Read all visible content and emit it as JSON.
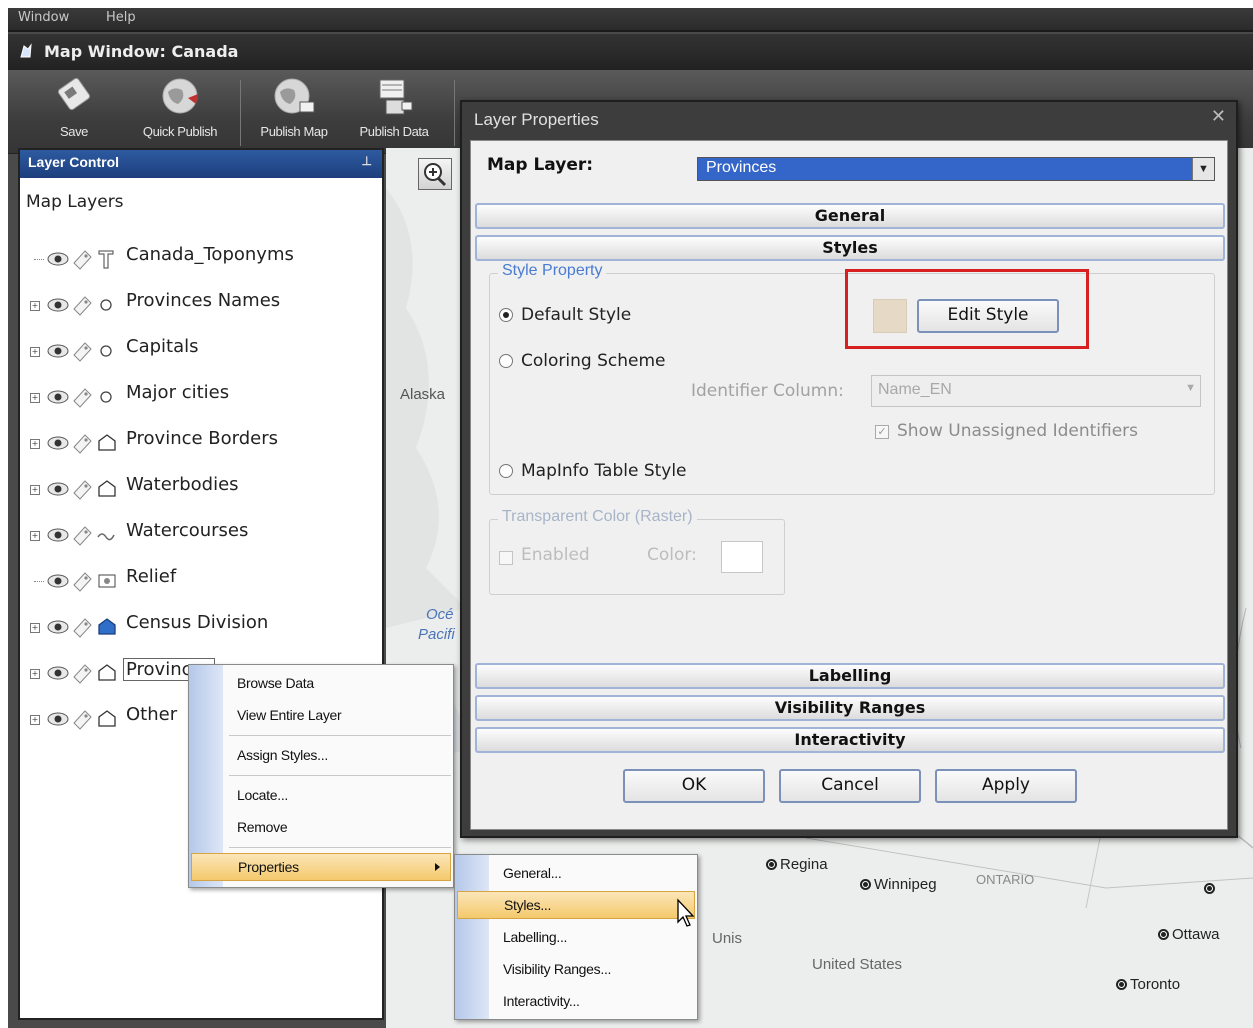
{
  "app": {
    "menu": [
      "Window",
      "Help"
    ],
    "window_title": "Map Window: Canada",
    "toolbar": [
      {
        "label": "Save",
        "icon": "save-icon"
      },
      {
        "label": "Quick Publish",
        "icon": "globe-icon"
      },
      {
        "label": "Publish Map",
        "icon": "globe-map-icon"
      },
      {
        "label": "Publish Data",
        "icon": "database-icon"
      }
    ]
  },
  "layer_control": {
    "title": "Layer Control",
    "root": "Map Layers",
    "layers": [
      {
        "name": "Canada_Toponyms",
        "type_icon": "text-icon",
        "expandable": false
      },
      {
        "name": "Provinces Names",
        "type_icon": "point-icon",
        "expandable": true
      },
      {
        "name": "Capitals",
        "type_icon": "point-icon",
        "expandable": true
      },
      {
        "name": "Major cities",
        "type_icon": "point-icon",
        "expandable": true
      },
      {
        "name": "Province Borders",
        "type_icon": "polygon-icon",
        "expandable": true
      },
      {
        "name": "Waterbodies",
        "type_icon": "polygon-icon",
        "expandable": true
      },
      {
        "name": "Watercourses",
        "type_icon": "line-icon",
        "expandable": true
      },
      {
        "name": "Relief",
        "type_icon": "raster-icon",
        "expandable": false
      },
      {
        "name": "Census Division",
        "type_icon": "polygon-filled-icon",
        "expandable": true
      },
      {
        "name": "Provinces",
        "type_icon": "polygon-icon",
        "expandable": true
      },
      {
        "name": "Other",
        "type_icon": "polygon-icon",
        "expandable": true
      }
    ]
  },
  "map": {
    "labels": {
      "alaska": "Alaska",
      "ocean1": "Océ",
      "ocean2": "Pacifi",
      "united_states": "United States",
      "unis": "Unis",
      "ontario": "ONTARIO"
    },
    "cities": [
      "Regina",
      "Winnipeg",
      "Ottawa",
      "Toronto"
    ]
  },
  "dialog": {
    "title": "Layer Properties",
    "map_layer_label": "Map Layer:",
    "map_layer_value": "Provinces",
    "sections": {
      "general": "General",
      "styles": "Styles",
      "labelling": "Labelling",
      "visibility": "Visibility Ranges",
      "interactivity": "Interactivity"
    },
    "style_property": {
      "legend": "Style Property",
      "default_style": "Default Style",
      "coloring_scheme": "Coloring Scheme",
      "identifier_column_label": "Identifier Column:",
      "identifier_column_value": "Name_EN",
      "show_unassigned": "Show Unassigned Identifiers",
      "mapinfo_table_style": "MapInfo Table Style",
      "edit_style": "Edit Style",
      "swatch_color": "#e6d9c5"
    },
    "transparent_color": {
      "legend": "Transparent Color (Raster)",
      "enabled": "Enabled",
      "color": "Color:"
    },
    "buttons": {
      "ok": "OK",
      "cancel": "Cancel",
      "apply": "Apply"
    }
  },
  "context_menu": {
    "items": [
      "Browse Data",
      "View Entire Layer",
      "Assign Styles...",
      "Locate...",
      "Remove",
      "Properties"
    ]
  },
  "submenu": {
    "items": [
      "General...",
      "Styles...",
      "Labelling...",
      "Visibility Ranges...",
      "Interactivity..."
    ]
  }
}
